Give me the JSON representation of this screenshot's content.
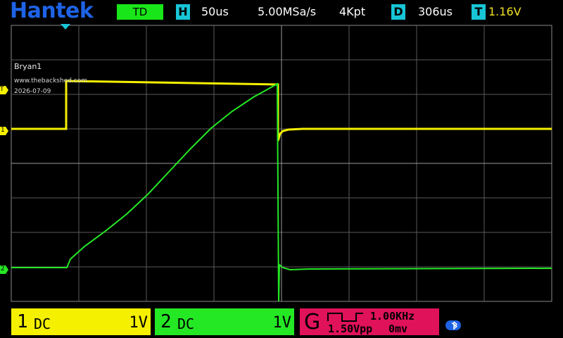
{
  "header": {
    "brand": "Hantek",
    "trigger_mode": "TD",
    "horizontal_tag": "H",
    "timebase": "50us",
    "sample_rate": "5.00MSa/s",
    "memory_depth": "4Kpt",
    "delay_tag": "D",
    "delay": "306us",
    "trigger_tag": "T",
    "trigger_level": "1.16V"
  },
  "overlay": {
    "name": "Bryan1",
    "website": "www.thebackshed.com",
    "date": "2026-07-09"
  },
  "markers": {
    "trigger_level_label": "T",
    "ch1_label": "1",
    "ch2_label": "2"
  },
  "channels": [
    {
      "name": "1",
      "coupling": "DC",
      "scale": "1V",
      "color": "#f5f000"
    },
    {
      "name": "2",
      "coupling": "DC",
      "scale": "1V",
      "color": "#25e825"
    }
  ],
  "generator": {
    "letter": "G",
    "frequency": "1.00KHz",
    "amplitude": "1.50Vpp",
    "offset": "0mv",
    "waveform_icon": "square-wave-icon",
    "color": "#e0125a"
  },
  "status": {
    "bluetooth_icon": "bluetooth-icon"
  },
  "colors": {
    "brand": "#1e63e6",
    "mode": "#19e619",
    "tag": "#17c6d6",
    "ch1": "#f5f000",
    "ch2": "#25e825"
  }
}
